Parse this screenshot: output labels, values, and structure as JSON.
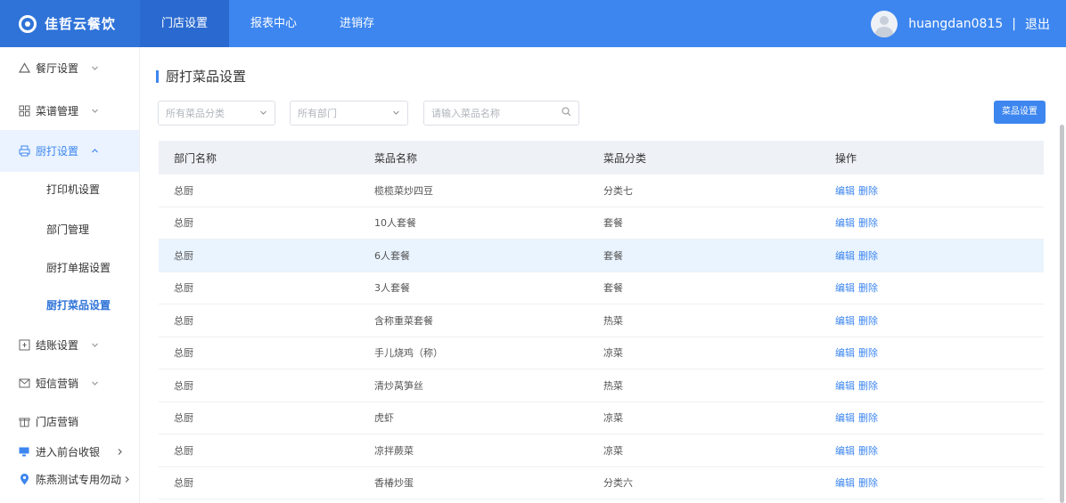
{
  "brand": {
    "name": "佳哲云餐饮"
  },
  "topnav": [
    {
      "label": "门店设置",
      "active": true
    },
    {
      "label": "报表中心",
      "active": false
    },
    {
      "label": "进销存",
      "active": false
    }
  ],
  "user": {
    "name": "huangdan0815",
    "separator": "|",
    "logout": "退出"
  },
  "sidebar": {
    "items": [
      {
        "label": "餐厅设置",
        "icon": "home-icon"
      },
      {
        "label": "菜谱管理",
        "icon": "grid-icon"
      },
      {
        "label": "厨打设置",
        "icon": "printer-icon"
      },
      {
        "label": "结账设置",
        "icon": "receipt-icon"
      },
      {
        "label": "短信营销",
        "icon": "mail-icon"
      },
      {
        "label": "门店营销",
        "icon": "gift-icon"
      },
      {
        "label": "进入前台收银",
        "icon": "monitor-icon"
      },
      {
        "label": "陈燕测试专用勿动",
        "icon": "location-pin-icon"
      }
    ],
    "subitems": [
      {
        "label": "打印机设置"
      },
      {
        "label": "部门管理"
      },
      {
        "label": "厨打单据设置"
      },
      {
        "label": "厨打菜品设置"
      }
    ]
  },
  "page": {
    "title": "厨打菜品设置"
  },
  "filters": {
    "category_placeholder": "所有菜品分类",
    "department_placeholder": "所有部门",
    "search_placeholder": "请输入菜品名称",
    "settings_button": "菜品设置"
  },
  "table": {
    "headers": [
      "部门名称",
      "菜品名称",
      "菜品分类",
      "操作"
    ],
    "action_edit": "编辑",
    "action_delete": "删除",
    "rows": [
      {
        "dept": "总厨",
        "dish": "榄榄菜炒四豆",
        "category": "分类七"
      },
      {
        "dept": "总厨",
        "dish": "10人套餐",
        "category": "套餐"
      },
      {
        "dept": "总厨",
        "dish": "6人套餐",
        "category": "套餐"
      },
      {
        "dept": "总厨",
        "dish": "3人套餐",
        "category": "套餐"
      },
      {
        "dept": "总厨",
        "dish": "含称重菜套餐",
        "category": "热菜"
      },
      {
        "dept": "总厨",
        "dish": "手儿烧鸡（称）",
        "category": "凉菜"
      },
      {
        "dept": "总厨",
        "dish": "清炒莴笋丝",
        "category": "热菜"
      },
      {
        "dept": "总厨",
        "dish": "虎虾",
        "category": "凉菜"
      },
      {
        "dept": "总厨",
        "dish": "凉拌蕨菜",
        "category": "凉菜"
      },
      {
        "dept": "总厨",
        "dish": "香椿炒蛋",
        "category": "分类六"
      }
    ]
  },
  "colors": {
    "primary": "#3d86ef",
    "brand_bg": "#2f73d8",
    "highlight_row": "#eaf4ff",
    "header_bg": "#eef1f6"
  }
}
